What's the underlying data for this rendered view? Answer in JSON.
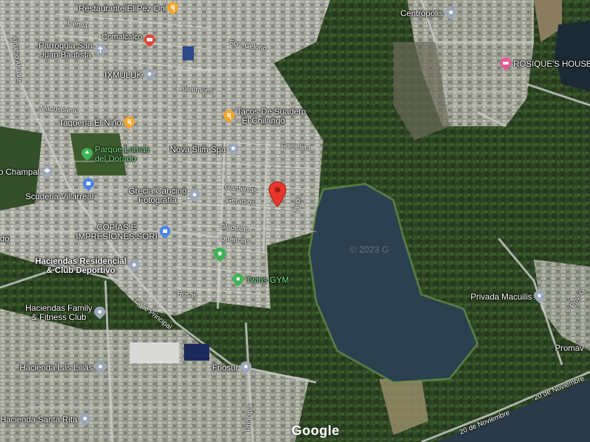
{
  "map": {
    "logo": "Google",
    "watermark": "© 2023 G",
    "pois": [
      {
        "name": "Restaurante El Pez On",
        "icon": "restaurant-icon",
        "color": "#f4a52a"
      },
      {
        "name": "Centrópolis",
        "icon": "place-icon",
        "color": "#9aa7b8"
      },
      {
        "name": "Parroquia San Juan Bautista",
        "line1": "Parroquia San",
        "line2": "Juan Bautista",
        "icon": "church-icon",
        "color": "#9aa7b8"
      },
      {
        "name": "Comalcalco",
        "icon": "dining-icon",
        "color": "#e0443a"
      },
      {
        "name": "ROSIQUE'S HOUSE",
        "icon": "hotel-icon",
        "color": "#e8579a"
      },
      {
        "name": "IXMULUK",
        "icon": "place-icon",
        "color": "#9aa7b8"
      },
      {
        "name": "Tacos De Suadero - El Chilango",
        "line1": "Tacos De Suadero",
        "line2": "- El Chilango",
        "icon": "restaurant-icon",
        "color": "#f4a52a"
      },
      {
        "name": "Taquería El Niño",
        "icon": "restaurant-icon",
        "color": "#f4a52a"
      },
      {
        "name": "Parque Lomas del Dorado",
        "line1": "Parque Lomas",
        "line2": "del Dorado",
        "icon": "park-icon",
        "color": "#3db455"
      },
      {
        "name": "Nova Slim Spa",
        "icon": "place-icon",
        "color": "#9aa7b8"
      },
      {
        "name": "o Champal",
        "icon": "school-icon",
        "color": "#9aa7b8"
      },
      {
        "name": "Grecia Cancino Fotografía",
        "line1": "Grecia Cancino",
        "line2": "Fotografía",
        "icon": "place-icon",
        "color": "#9aa7b8"
      },
      {
        "name": "Scuderia Villarreal",
        "icon": "shopping-icon",
        "color": "#4a84e8"
      },
      {
        "name": "COPIAS E IMPRESIONES SORI",
        "line1": "COPIAS E",
        "line2": "IMPRESIONES SORI",
        "icon": "shopping-icon",
        "color": "#4a84e8"
      },
      {
        "name": "do",
        "icon": "none"
      },
      {
        "name": "Haciendas Residencial & Club Deportivo",
        "line1": "Haciendas Residencial",
        "line2": "& Club Deportivo",
        "icon": "place-icon",
        "color": "#9aa7b8"
      },
      {
        "name": "Twins GYM",
        "icon": "gym-icon",
        "color": "#3db455"
      },
      {
        "name": "Haciendas Family & Fitness Club",
        "line1": "Haciendas Family",
        "line2": "& Fitness Club",
        "icon": "place-icon",
        "color": "#9aa7b8"
      },
      {
        "name": "Privada Macuilis",
        "icon": "place-icon",
        "color": "#9aa7b8"
      },
      {
        "name": "Promav",
        "icon": "none"
      },
      {
        "name": "Hacienda Las Lilias",
        "icon": "place-icon",
        "color": "#9aa7b8"
      },
      {
        "name": "Friosur",
        "icon": "place-icon",
        "color": "#9aa7b8"
      },
      {
        "name": "Hacienda Santa Rita",
        "icon": "place-icon",
        "color": "#9aa7b8"
      }
    ],
    "streets": [
      "Centla",
      "Fco. Celorio",
      "Alcatraces",
      "Macuspana",
      "Camelias",
      "Gardenias",
      "Geranios",
      "Lirios",
      "Gladiolas",
      "Ortencias",
      "Rosas",
      "Calle Principal",
      "Principal",
      "20 de Noviembre",
      "20 de Noviembre",
      "Ignacio Allende",
      "Priv. G"
    ],
    "selected_marker": "red-location-marker",
    "colors": {
      "water": "#2c4050",
      "urban": "#8c8f88",
      "forest": "#2f4a26",
      "road": "#c7c9c5"
    }
  }
}
